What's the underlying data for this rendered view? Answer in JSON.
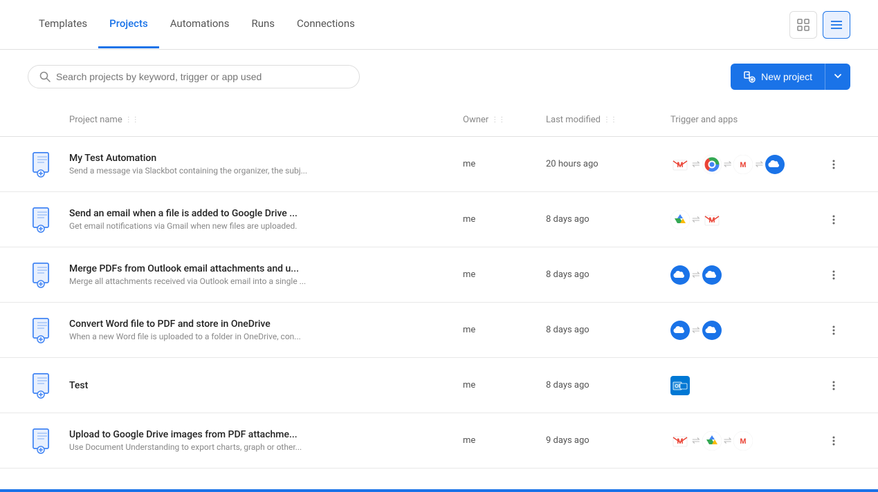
{
  "nav": {
    "tabs": [
      {
        "id": "templates",
        "label": "Templates",
        "active": false
      },
      {
        "id": "projects",
        "label": "Projects",
        "active": true
      },
      {
        "id": "automations",
        "label": "Automations",
        "active": false
      },
      {
        "id": "runs",
        "label": "Runs",
        "active": false
      },
      {
        "id": "connections",
        "label": "Connections",
        "active": false
      }
    ]
  },
  "search": {
    "placeholder": "Search projects by keyword, trigger or app used",
    "value": ""
  },
  "new_project_button": "New project",
  "columns": {
    "project_name": "Project name",
    "owner": "Owner",
    "last_modified": "Last modified",
    "trigger_and_apps": "Trigger and apps"
  },
  "projects": [
    {
      "id": 1,
      "name": "My Test Automation",
      "description": "Send a message via Slackbot containing the organizer, the subj...",
      "owner": "me",
      "modified": "20 hours ago",
      "apps": [
        "gmail",
        "chrome",
        "gmail2",
        "cloud"
      ]
    },
    {
      "id": 2,
      "name": "Send an email when a file is added to Google Drive ...",
      "description": "Get email notifications via Gmail when new files are uploaded.",
      "owner": "me",
      "modified": "8 days ago",
      "apps": [
        "gdrive",
        "gmail"
      ]
    },
    {
      "id": 3,
      "name": "Merge PDFs from Outlook email attachments and u...",
      "description": "Merge all attachments received via Outlook email into a single ...",
      "owner": "me",
      "modified": "8 days ago",
      "apps": [
        "cloud1",
        "cloud2"
      ]
    },
    {
      "id": 4,
      "name": "Convert Word file to PDF and store in OneDrive",
      "description": "When a new Word file is uploaded to a folder in OneDrive, con...",
      "owner": "me",
      "modified": "8 days ago",
      "apps": [
        "cloud1",
        "cloud2"
      ]
    },
    {
      "id": 5,
      "name": "Test",
      "description": "",
      "owner": "me",
      "modified": "8 days ago",
      "apps": [
        "outlook"
      ]
    },
    {
      "id": 6,
      "name": "Upload to Google Drive images from PDF attachme...",
      "description": "Use Document Understanding to export charts, graph or other...",
      "owner": "me",
      "modified": "9 days ago",
      "apps": [
        "gmail",
        "gdrive",
        "gmail2"
      ]
    }
  ]
}
